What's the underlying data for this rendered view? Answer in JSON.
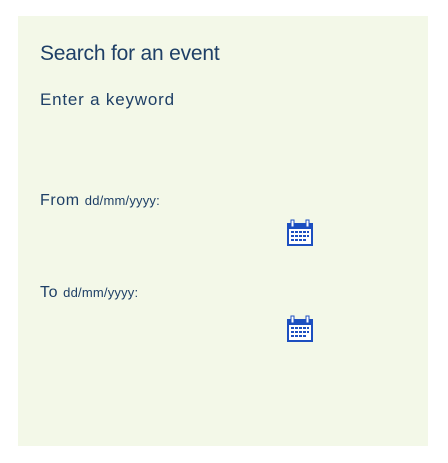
{
  "search": {
    "title": "Search for an event",
    "keyword_label": "Enter a keyword",
    "from_prefix": "From",
    "from_format": "dd/mm/yyyy:",
    "to_prefix": "To",
    "to_format": "dd/mm/yyyy:",
    "from_picker_icon": "calendar-icon",
    "to_picker_icon": "calendar-icon"
  },
  "colors": {
    "panel_background": "#f3f8e8",
    "text": "#1e3f66",
    "calendar_blue": "#1c4fc0"
  }
}
